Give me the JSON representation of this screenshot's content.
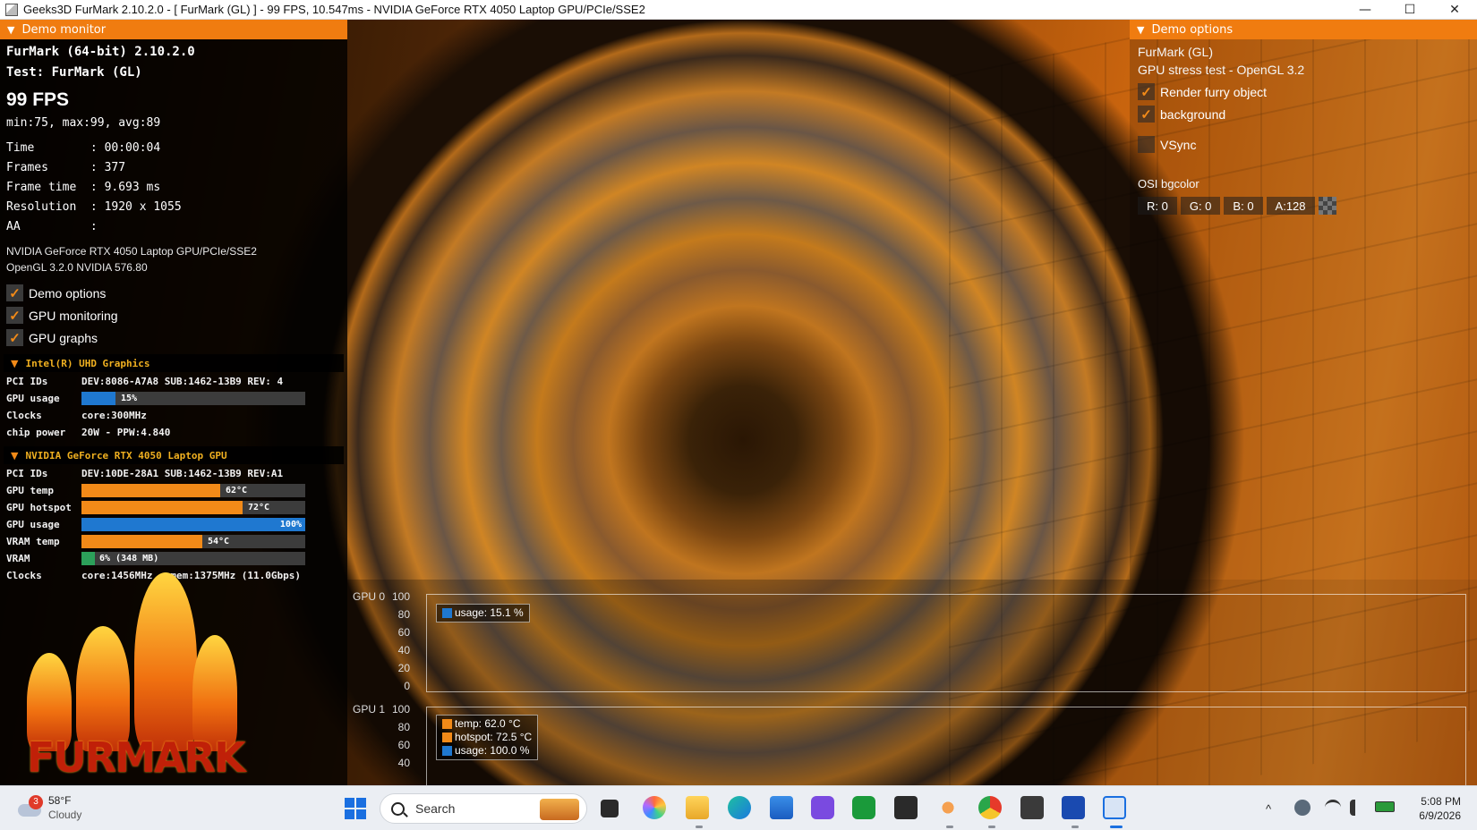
{
  "window": {
    "title": "Geeks3D FurMark 2.10.2.0 - [ FurMark (GL) ] - 99 FPS, 10.547ms - NVIDIA GeForce RTX 4050 Laptop GPU/PCIe/SSE2",
    "minimize": "—",
    "maximize": "☐",
    "close": "✕"
  },
  "demo_monitor": {
    "header": "Demo monitor",
    "app_line": "FurMark (64-bit) 2.10.2.0",
    "test_line": "Test: FurMark (GL)",
    "fps": "99 FPS",
    "fps_stats": "min:75, max:99, avg:89",
    "time": "Time        : 00:00:04",
    "frames": "Frames      : 377",
    "frame_time": "Frame time  : 9.693 ms",
    "resolution": "Resolution  : 1920 x 1055",
    "aa": "AA          :",
    "renderer": "NVIDIA GeForce RTX 4050 Laptop GPU/PCIe/SSE2",
    "opengl": "OpenGL 3.2.0 NVIDIA 576.80",
    "checks": [
      "Demo options",
      "GPU monitoring",
      "GPU graphs"
    ],
    "check_mark": "✓"
  },
  "intel_gpu": {
    "header": "Intel(R) UHD Graphics",
    "pci_key": "PCI IDs",
    "pci_val": "DEV:8086-A7A8 SUB:1462-13B9 REV: 4",
    "usage_key": "GPU usage",
    "usage_val": "15%",
    "usage_frac": 0.15,
    "clocks_key": "Clocks",
    "clocks_val": "core:300MHz",
    "power_key": "chip power",
    "power_val": "20W - PPW:4.840"
  },
  "nvidia_gpu": {
    "header": "NVIDIA GeForce RTX 4050 Laptop GPU",
    "pci_key": "PCI IDs",
    "pci_val": "DEV:10DE-28A1 SUB:1462-13B9 REV:A1",
    "temp_key": "GPU temp",
    "temp_val": "62°C",
    "temp_frac": 0.62,
    "hotspot_key": "GPU hotspot",
    "hotspot_val": "72°C",
    "hotspot_frac": 0.72,
    "usage_key": "GPU usage",
    "usage_val": "100%",
    "usage_frac": 1.0,
    "vram_temp_key": "VRAM temp",
    "vram_temp_val": "54°C",
    "vram_temp_frac": 0.54,
    "vram_key": "VRAM",
    "vram_val": "6% (348 MB)",
    "vram_frac": 0.06,
    "clocks_key": "Clocks",
    "clocks_val": "core:1456MHz - mem:1375MHz (11.0Gbps)"
  },
  "logo_text": "FURMARK",
  "demo_options": {
    "header": "Demo options",
    "name": "FurMark (GL)",
    "desc": "GPU stress test - OpenGL 3.2",
    "render_furry": "Render furry object",
    "background": "background",
    "vsync": "VSync",
    "osi_label": "OSI bgcolor",
    "r": "R: 0",
    "g": "G: 0",
    "b": "B: 0",
    "a": "A:128"
  },
  "graphs": {
    "gpu0": {
      "name": "GPU 0",
      "ticks": [
        "100",
        "80",
        "60",
        "40",
        "20",
        "0"
      ],
      "legend": [
        {
          "label": "usage: 15.1 %",
          "color": "#1f78d0"
        }
      ]
    },
    "gpu1": {
      "name": "GPU 1",
      "ticks": [
        "100",
        "80",
        "60",
        "40"
      ],
      "legend": [
        {
          "label": "temp: 62.0 °C",
          "color": "#f28a18"
        },
        {
          "label": "hotspot: 72.5 °C",
          "color": "#f28a18"
        },
        {
          "label": "usage: 100.0 %",
          "color": "#1f78d0"
        }
      ]
    }
  },
  "taskbar": {
    "weather_badge": "3",
    "weather_temp": "58°F",
    "weather_desc": "Cloudy",
    "search_placeholder": "Search",
    "time": "5:08 PM",
    "date": "6/9/2026",
    "tray_chevron": "^"
  },
  "colors": {
    "accent": "#f07c10",
    "usage_blue": "#1f78d0",
    "temp_orange": "#f28a18",
    "vram_green": "#2ca05a"
  }
}
